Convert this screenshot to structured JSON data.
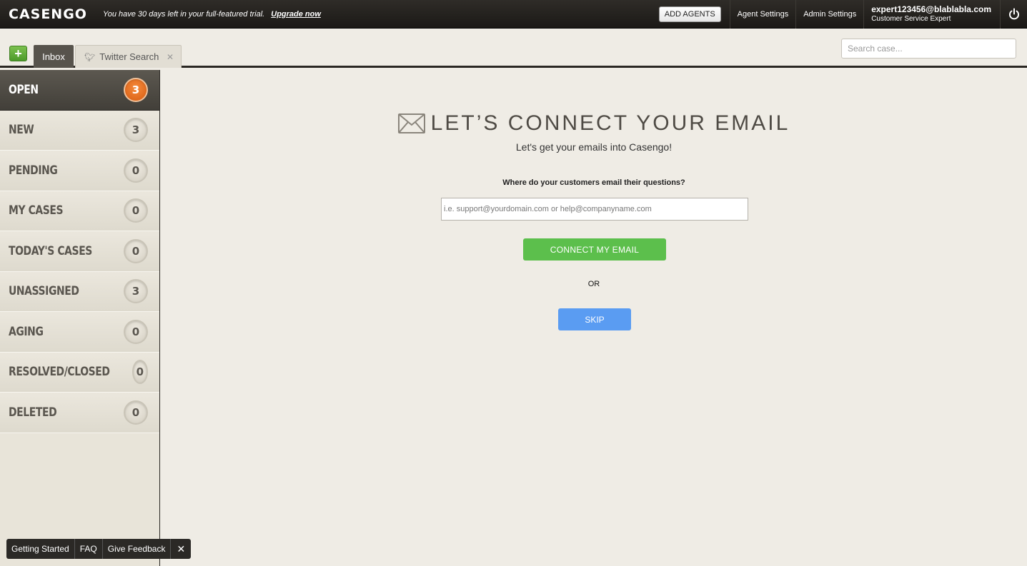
{
  "app": {
    "logo": "CASENGO",
    "trial_text": "You have 30 days left in your full-featured trial.",
    "upgrade_label": "Upgrade now"
  },
  "topbar": {
    "add_agents_label": "ADD AGENTS",
    "agent_settings_label": "Agent Settings",
    "admin_settings_label": "Admin Settings",
    "user_email": "expert123456@blablabla.com",
    "user_role": "Customer Service Expert",
    "power_icon": "power-icon"
  },
  "tabs": [
    {
      "label": "Inbox",
      "active": true
    },
    {
      "label": "Twitter Search",
      "active": false,
      "icon": "twitter-bird-icon"
    }
  ],
  "search": {
    "placeholder": "Search case..."
  },
  "sidebar": {
    "items": [
      {
        "label": "OPEN",
        "count": "3",
        "active": true
      },
      {
        "label": "NEW",
        "count": "3"
      },
      {
        "label": "PENDING",
        "count": "0"
      },
      {
        "label": "MY CASES",
        "count": "0"
      },
      {
        "label": "TODAY'S CASES",
        "count": "0"
      },
      {
        "label": "UNASSIGNED",
        "count": "3"
      },
      {
        "label": "AGING",
        "count": "0"
      },
      {
        "label": "RESOLVED/CLOSED",
        "count": "0"
      },
      {
        "label": "DELETED",
        "count": "0"
      }
    ]
  },
  "main": {
    "title": "LET’S CONNECT YOUR EMAIL",
    "subtitle": "Let's get your emails into Casengo!",
    "question": "Where do your customers email their questions?",
    "email_placeholder": "i.e. support@yourdomain.com or help@companyname.com",
    "connect_label": "CONNECT MY EMAIL",
    "or_label": "OR",
    "skip_label": "SKIP"
  },
  "helpbar": {
    "items": [
      "Getting Started",
      "FAQ",
      "Give Feedback"
    ],
    "close_label": "✕"
  },
  "colors": {
    "accent_orange": "#e9701f",
    "connect_green": "#5cbf4c",
    "skip_blue": "#5a9cf2",
    "topbar_dark": "#1b1916"
  }
}
